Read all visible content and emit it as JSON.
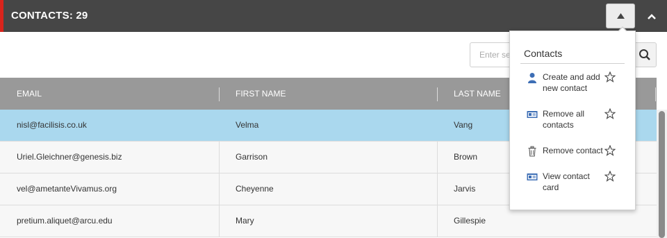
{
  "header": {
    "title": "CONTACTS: 29",
    "accent_color": "#d9241c",
    "background": "#464646",
    "menu_button_icon": "triangle-up-icon",
    "collapse_icon": "chevron-up-icon"
  },
  "search": {
    "placeholder": "Enter search term",
    "value": "",
    "button_icon": "search-icon"
  },
  "grid": {
    "columns": [
      "EMAIL",
      "FIRST NAME",
      "LAST NAME"
    ],
    "rows": [
      {
        "email": "nisl@facilisis.co.uk",
        "first_name": "Velma",
        "last_name": "Vang",
        "selected": true
      },
      {
        "email": "Uriel.Gleichner@genesis.biz",
        "first_name": "Garrison",
        "last_name": "Brown",
        "selected": false
      },
      {
        "email": "vel@ametanteVivamus.org",
        "first_name": "Cheyenne",
        "last_name": "Jarvis",
        "selected": false
      },
      {
        "email": "pretium.aliquet@arcu.edu",
        "first_name": "Mary",
        "last_name": "Gillespie",
        "selected": false
      }
    ],
    "selected_row_color": "#aad8ee"
  },
  "menu": {
    "title": "Contacts",
    "items": [
      {
        "label": "Create and add new contact",
        "icon": "person-icon"
      },
      {
        "label": "Remove all contacts",
        "icon": "contact-card-icon"
      },
      {
        "label": "Remove contact",
        "icon": "trash-icon"
      },
      {
        "label": "View contact card",
        "icon": "contact-card-icon"
      }
    ],
    "favorite_icon": "star-outline-icon"
  }
}
